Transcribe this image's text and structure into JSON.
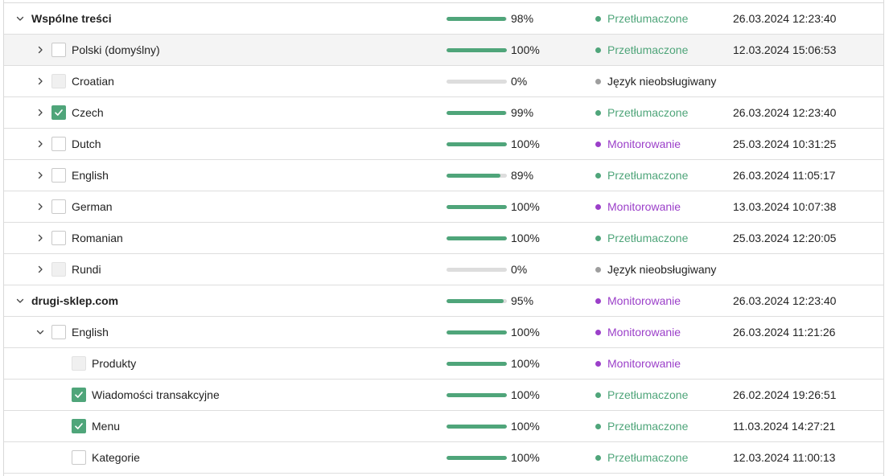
{
  "colors": {
    "translated": "#4fa57a",
    "monitoring": "#9b3fc9",
    "unsupported": "#9e9e9e",
    "text": "#222222"
  },
  "status_styles": {
    "Przetłumaczone": "translated",
    "Monitorowanie": "monitoring",
    "Język nieobsługiwany": "unsupported"
  },
  "rows": [
    {
      "level": 0,
      "name": "Wspólne treści",
      "bold": true,
      "chevron": "down",
      "checkbox": "none",
      "progress": 98,
      "percent": "98%",
      "status": "Przetłumaczone",
      "date": "26.03.2024 12:23:40"
    },
    {
      "level": 1,
      "name": "Polski (domyślny)",
      "bold": false,
      "chevron": "right",
      "checkbox": "unchecked",
      "progress": 100,
      "percent": "100%",
      "status": "Przetłumaczone",
      "date": "12.03.2024 15:06:53",
      "hover": true
    },
    {
      "level": 1,
      "name": "Croatian",
      "bold": false,
      "chevron": "right",
      "checkbox": "disabled",
      "progress": 0,
      "percent": "0%",
      "status": "Język nieobsługiwany",
      "date": ""
    },
    {
      "level": 1,
      "name": "Czech",
      "bold": false,
      "chevron": "right",
      "checkbox": "checked",
      "progress": 99,
      "percent": "99%",
      "status": "Przetłumaczone",
      "date": "26.03.2024 12:23:40"
    },
    {
      "level": 1,
      "name": "Dutch",
      "bold": false,
      "chevron": "right",
      "checkbox": "unchecked",
      "progress": 100,
      "percent": "100%",
      "status": "Monitorowanie",
      "date": "25.03.2024 10:31:25"
    },
    {
      "level": 1,
      "name": "English",
      "bold": false,
      "chevron": "right",
      "checkbox": "unchecked",
      "progress": 89,
      "percent": "89%",
      "status": "Przetłumaczone",
      "date": "26.03.2024 11:05:17"
    },
    {
      "level": 1,
      "name": "German",
      "bold": false,
      "chevron": "right",
      "checkbox": "unchecked",
      "progress": 100,
      "percent": "100%",
      "status": "Monitorowanie",
      "date": "13.03.2024 10:07:38"
    },
    {
      "level": 1,
      "name": "Romanian",
      "bold": false,
      "chevron": "right",
      "checkbox": "unchecked",
      "progress": 100,
      "percent": "100%",
      "status": "Przetłumaczone",
      "date": "25.03.2024 12:20:05"
    },
    {
      "level": 1,
      "name": "Rundi",
      "bold": false,
      "chevron": "right",
      "checkbox": "disabled",
      "progress": 0,
      "percent": "0%",
      "status": "Język nieobsługiwany",
      "date": ""
    },
    {
      "level": 0,
      "name": "drugi-sklep.com",
      "bold": true,
      "chevron": "down",
      "checkbox": "none",
      "progress": 95,
      "percent": "95%",
      "status": "Monitorowanie",
      "date": "26.03.2024 12:23:40"
    },
    {
      "level": 1,
      "name": "English",
      "bold": false,
      "chevron": "down",
      "checkbox": "unchecked",
      "progress": 100,
      "percent": "100%",
      "status": "Monitorowanie",
      "date": "26.03.2024 11:21:26"
    },
    {
      "level": 2,
      "name": "Produkty",
      "bold": false,
      "chevron": "none",
      "checkbox": "disabled",
      "progress": 100,
      "percent": "100%",
      "status": "Monitorowanie",
      "date": ""
    },
    {
      "level": 2,
      "name": "Wiadomości transakcyjne",
      "bold": false,
      "chevron": "none",
      "checkbox": "checked",
      "progress": 100,
      "percent": "100%",
      "status": "Przetłumaczone",
      "date": "26.02.2024 19:26:51"
    },
    {
      "level": 2,
      "name": "Menu",
      "bold": false,
      "chevron": "none",
      "checkbox": "checked",
      "progress": 100,
      "percent": "100%",
      "status": "Przetłumaczone",
      "date": "11.03.2024 14:27:21"
    },
    {
      "level": 2,
      "name": "Kategorie",
      "bold": false,
      "chevron": "none",
      "checkbox": "unchecked",
      "progress": 100,
      "percent": "100%",
      "status": "Przetłumaczone",
      "date": "12.03.2024 11:00:13"
    }
  ]
}
